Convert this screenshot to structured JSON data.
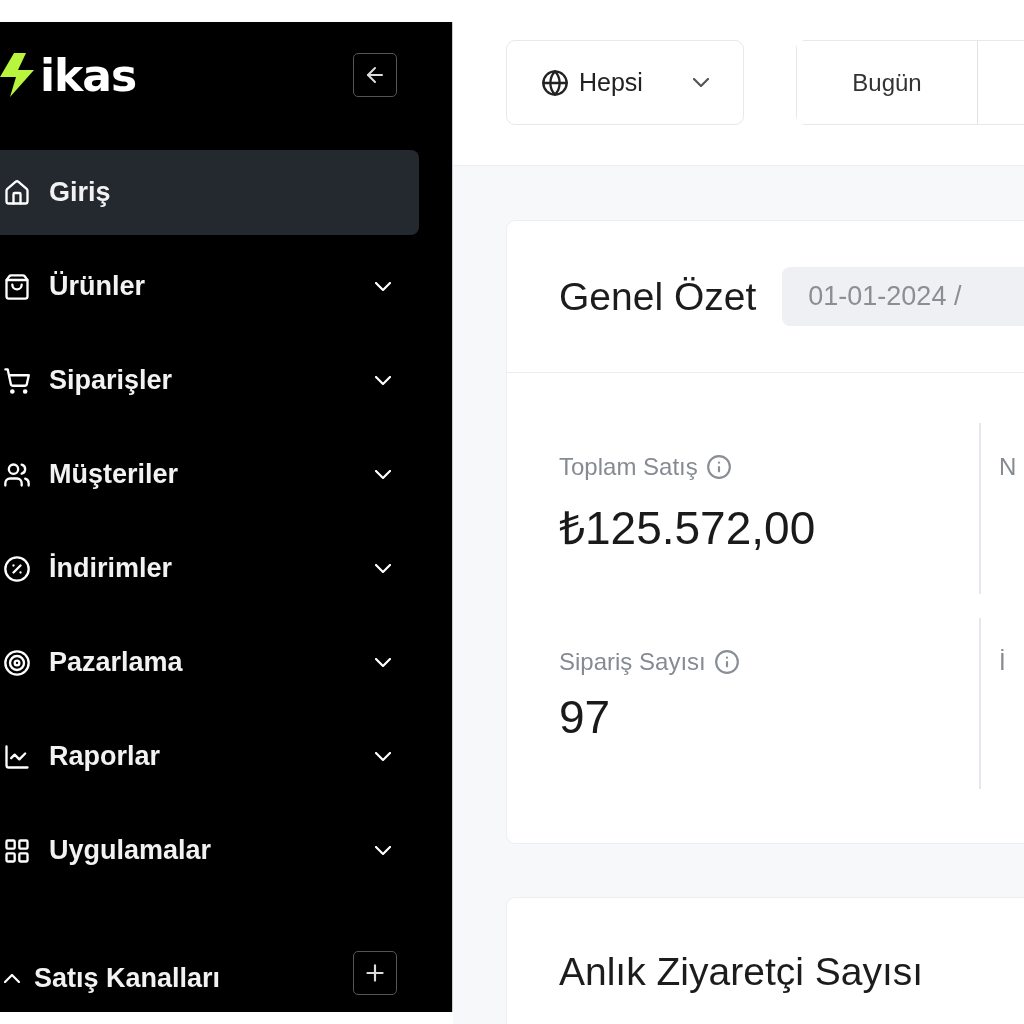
{
  "sidebar": {
    "logo": "ikas",
    "items": [
      {
        "label": "Giriş",
        "selected": true,
        "has_submenu": false
      },
      {
        "label": "Ürünler",
        "selected": false,
        "has_submenu": true
      },
      {
        "label": "Siparişler",
        "selected": false,
        "has_submenu": true
      },
      {
        "label": "Müşteriler",
        "selected": false,
        "has_submenu": true
      },
      {
        "label": "İndirimler",
        "selected": false,
        "has_submenu": true
      },
      {
        "label": "Pazarlama",
        "selected": false,
        "has_submenu": true
      },
      {
        "label": "Raporlar",
        "selected": false,
        "has_submenu": true
      },
      {
        "label": "Uygulamalar",
        "selected": false,
        "has_submenu": true
      }
    ],
    "section": {
      "label": "Satış Kanalları",
      "expanded": true
    }
  },
  "toolbar": {
    "channel_select": "Hepsi",
    "date_ranges": [
      "Bugün"
    ]
  },
  "summary": {
    "title": "Genel Özet",
    "date_range": "01-01-2024 /",
    "rows": [
      [
        {
          "label": "Toplam Satış",
          "value": "₺125.572,00"
        },
        {
          "label": "N"
        }
      ],
      [
        {
          "label": "Sipariş Sayısı",
          "value": "97"
        },
        {
          "label": "İ"
        }
      ]
    ]
  },
  "visitors": {
    "title": "Anlık Ziyaretçi Sayısı"
  }
}
